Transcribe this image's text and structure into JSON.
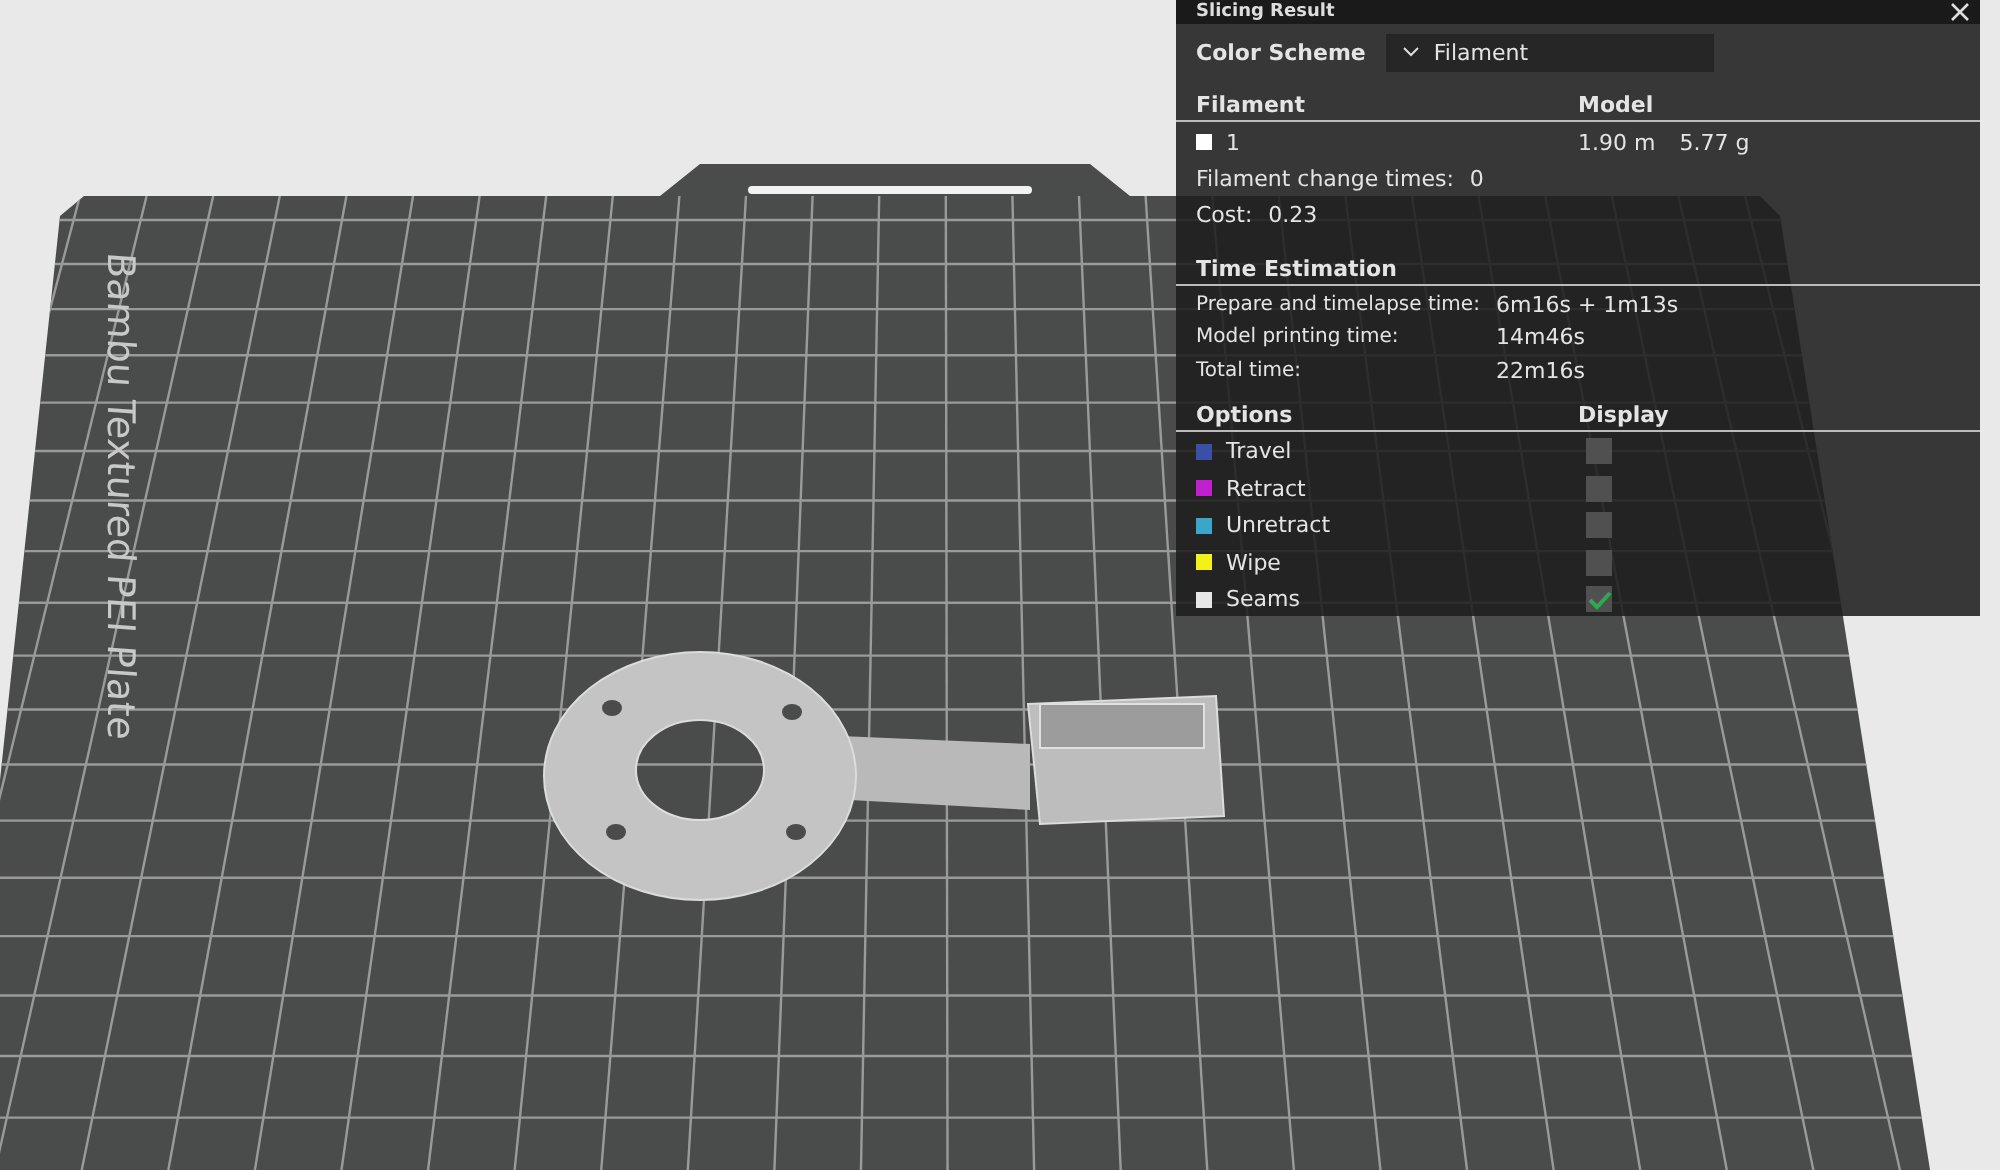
{
  "viewport": {
    "plate_label": "Bambu Textured PEI Plate"
  },
  "panel": {
    "title": "Slicing Result",
    "color_scheme": {
      "label": "Color Scheme",
      "value": "Filament"
    },
    "filament_header": {
      "column_1": "Filament",
      "column_2": "Model"
    },
    "filaments": [
      {
        "name": "1",
        "color": "#ffffff",
        "length": "1.90 m",
        "weight": "5.77 g"
      }
    ],
    "summary": [
      {
        "label": "Filament change times:",
        "value": "0"
      },
      {
        "label": "Cost:",
        "value": "0.23"
      }
    ],
    "time_title": "Time Estimation",
    "times": [
      {
        "label": "Prepare and timelapse time:",
        "value": "6m16s + 1m13s"
      },
      {
        "label": "Model printing time:",
        "value": "14m46s"
      },
      {
        "label": "Total time:",
        "value": "22m16s"
      }
    ],
    "options_header": {
      "column_1": "Options",
      "column_2": "Display"
    },
    "options": [
      {
        "name": "Travel",
        "color": "#3b4ea8",
        "checked": false
      },
      {
        "name": "Retract",
        "color": "#c21fd0",
        "checked": false
      },
      {
        "name": "Unretract",
        "color": "#3aa6c8",
        "checked": false
      },
      {
        "name": "Wipe",
        "color": "#f2f21a",
        "checked": false
      },
      {
        "name": "Seams",
        "color": "#e6e6e6",
        "checked": true
      }
    ]
  }
}
